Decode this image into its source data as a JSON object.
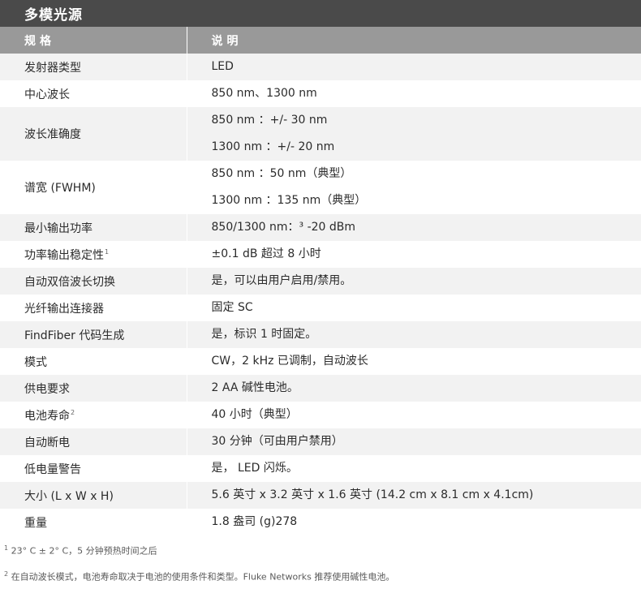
{
  "title": "多模光源",
  "header": {
    "col1": "规格",
    "col2": "说明"
  },
  "rows": [
    {
      "label": "发射器类型",
      "values": [
        "LED"
      ]
    },
    {
      "label": "中心波长",
      "values": [
        "850 nm、1300 nm"
      ]
    },
    {
      "label": "波长准确度",
      "values": [
        "850 nm ：+/- 30 nm",
        "1300 nm ：+/- 20 nm"
      ]
    },
    {
      "label": "谱宽 (FWHM)",
      "values": [
        "850 nm ：50 nm（典型）",
        "1300 nm ：135 nm（典型）"
      ]
    },
    {
      "label": "最小输出功率",
      "values": [
        "850/1300 nm：³ -20 dBm"
      ]
    },
    {
      "label": "功率输出稳定性",
      "sup": "1",
      "values": [
        "±0.1 dB 超过 8 小时"
      ]
    },
    {
      "label": "自动双倍波长切换",
      "values": [
        "是，可以由用户启用/禁用。"
      ]
    },
    {
      "label": "光纤输出连接器",
      "values": [
        "固定 SC"
      ]
    },
    {
      "label": "FindFiber 代码生成",
      "values": [
        "是，标识 1 时固定。"
      ]
    },
    {
      "label": "模式",
      "values": [
        "CW，2 kHz 已调制，自动波长"
      ]
    },
    {
      "label": "供电要求",
      "values": [
        "2 AA 碱性电池。"
      ]
    },
    {
      "label": "电池寿命",
      "sup": "2",
      "values": [
        "40 小时（典型）"
      ]
    },
    {
      "label": "自动断电",
      "values": [
        "30 分钟（可由用户禁用）"
      ]
    },
    {
      "label": "低电量警告",
      "values": [
        "是， LED 闪烁。"
      ]
    },
    {
      "label": "大小 (L x W x H)",
      "values": [
        "5.6 英寸 x 3.2 英寸 x 1.6 英寸 (14.2 cm x 8.1 cm x 4.1cm)"
      ]
    },
    {
      "label": "重量",
      "values": [
        "1.8 盎司 (g)278"
      ]
    }
  ],
  "footnotes": [
    {
      "mark": "1",
      "text": "23° C ± 2° C，5 分钟预热时间之后"
    },
    {
      "mark": "2",
      "text": "在自动波长模式，电池寿命取决于电池的使用条件和类型。Fluke Networks 推荐使用碱性电池。"
    }
  ]
}
